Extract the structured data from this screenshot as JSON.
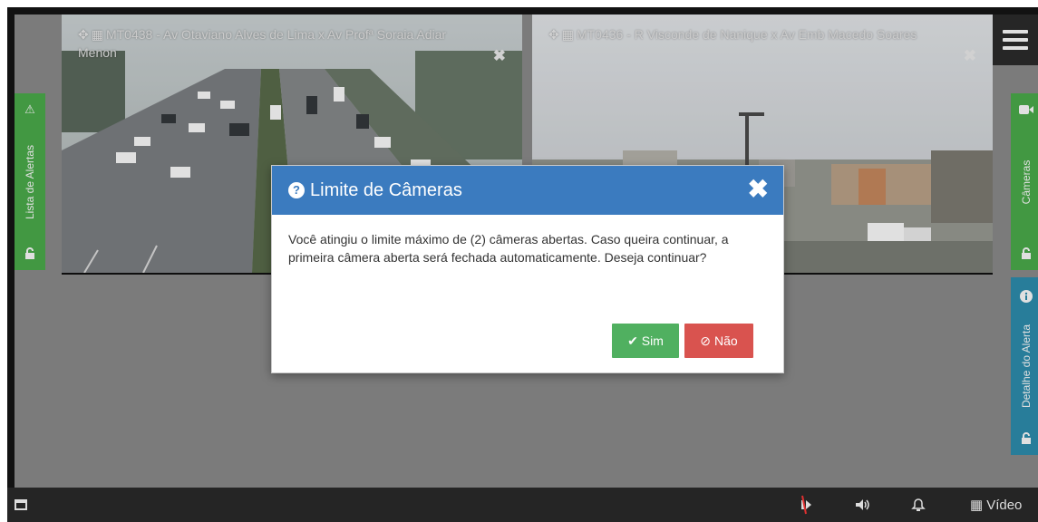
{
  "cameras": [
    {
      "id": "MT0438",
      "title": "MT0438 - Av Otaviano Alves de Lima x Av Profª Soraia Adiar Menon",
      "close_label": "✖"
    },
    {
      "id": "MT0436",
      "title": "MT0436 - R Visconde de Nanique x Av Emb Macedo Soares",
      "close_label": "✖"
    }
  ],
  "side_tabs": {
    "left": {
      "label": "Lista de Alertas",
      "top_icon": "warning-icon",
      "bottom_icon": "unlock-icon"
    },
    "right_top": {
      "label": "Câmeras",
      "top_icon": "video-camera-icon",
      "bottom_icon": "unlock-icon"
    },
    "right_bottom": {
      "label": "Detalhe do Alerta",
      "top_icon": "info-icon",
      "bottom_icon": "unlock-icon"
    }
  },
  "modal": {
    "title": "Limite de Câmeras",
    "message": "Você atingiu o limite máximo de (2) câmeras abertas. Caso queira continuar, a primeira câmera aberta será fechada automaticamente. Deseja continuar?",
    "confirm_label": "Sim",
    "cancel_label": "Não",
    "close_glyph": "✖"
  },
  "bottom_bar": {
    "video_label": "Vídeo"
  },
  "colors": {
    "modal_header": "#3b7bbf",
    "confirm": "#50b060",
    "cancel": "#d9534f",
    "tab_green": "#4cae4c",
    "tab_blue": "#2e8fb0"
  }
}
